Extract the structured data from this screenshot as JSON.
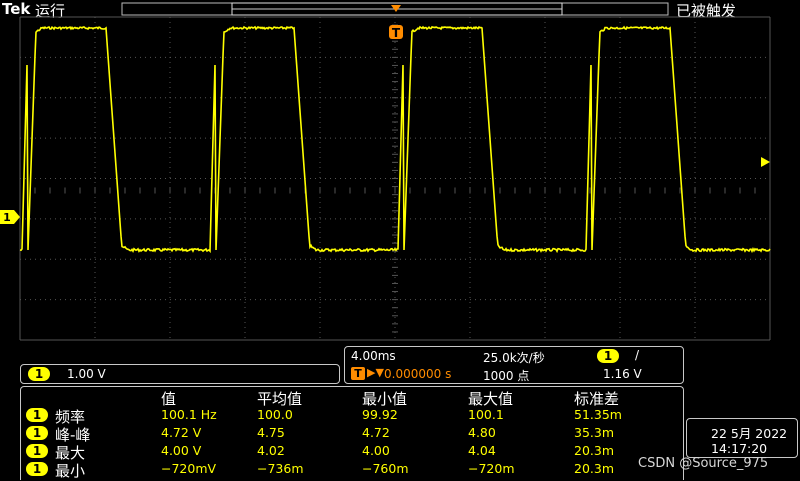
{
  "header": {
    "brand": "Tek",
    "run_state": "运行",
    "trigger_status": "已被触发"
  },
  "channel": {
    "number": "1",
    "scale": "1.00 V",
    "color": "#ffff00"
  },
  "timebase": {
    "horizontal_scale": "4.00ms",
    "trigger_position": "0.000000 s",
    "sample_rate": "25.0k次/秒",
    "record_length": "1000 点",
    "trigger_source": "1",
    "trigger_slope": "/",
    "trigger_level": "1.16 V"
  },
  "measurements": {
    "headers": [
      "值",
      "平均值",
      "最小值",
      "最大值",
      "标准差"
    ],
    "rows": [
      {
        "channel": "1",
        "name": "频率",
        "value": "100.1 Hz",
        "mean": "100.0",
        "min": "99.92",
        "max": "100.1",
        "std": "51.35m"
      },
      {
        "channel": "1",
        "name": "峰-峰",
        "value": "4.72 V",
        "mean": "4.75",
        "min": "4.72",
        "max": "4.80",
        "std": "35.3m"
      },
      {
        "channel": "1",
        "name": "最大",
        "value": "4.00 V",
        "mean": "4.02",
        "min": "4.00",
        "max": "4.04",
        "std": "20.3m"
      },
      {
        "channel": "1",
        "name": "最小",
        "value": "−720mV",
        "mean": "−736m",
        "min": "−760m",
        "max": "−720m",
        "std": "20.3m"
      }
    ]
  },
  "clock": {
    "date": "22 5月 2022",
    "time": "14:17:20"
  },
  "watermark": "CSDN @Source_975",
  "trigger_marker": "T"
}
